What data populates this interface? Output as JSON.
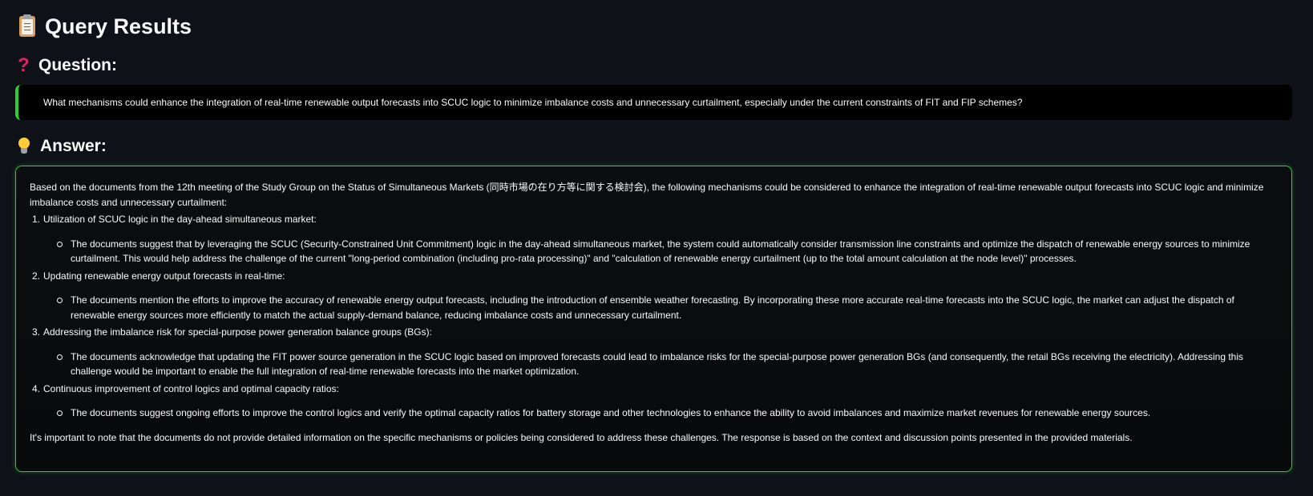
{
  "page": {
    "title": "Query Results",
    "question_heading": "Question:",
    "answer_heading": "Answer:"
  },
  "icons": {
    "title_icon": "clipboard-icon",
    "question_icon": "question-mark-icon",
    "answer_icon": "light-bulb-icon"
  },
  "colors": {
    "background": "#0e1117",
    "accent_green": "#2bd02b",
    "question_mark_red": "#e0245e"
  },
  "question": {
    "text": "What mechanisms could enhance the integration of real-time renewable output forecasts into SCUC logic to minimize imbalance costs and unnecessary curtailment, especially under the current constraints of FIT and FIP schemes?"
  },
  "answer": {
    "intro": "Based on the documents from the 12th meeting of the Study Group on the Status of Simultaneous Markets (同時市場の在り方等に関する検討会), the following mechanisms could be considered to enhance the integration of real-time renewable output forecasts into SCUC logic and minimize imbalance costs and unnecessary curtailment:",
    "points": [
      {
        "number": "1.",
        "title": "Utilization of SCUC logic in the day-ahead simultaneous market:",
        "detail": "The documents suggest that by leveraging the SCUC (Security-Constrained Unit Commitment) logic in the day-ahead simultaneous market, the system could automatically consider transmission line constraints and optimize the dispatch of renewable energy sources to minimize curtailment. This would help address the challenge of the current \"long-period combination (including pro-rata processing)\" and \"calculation of renewable energy curtailment (up to the total amount calculation at the node level)\" processes."
      },
      {
        "number": "2.",
        "title": "Updating renewable energy output forecasts in real-time:",
        "detail": "The documents mention the efforts to improve the accuracy of renewable energy output forecasts, including the introduction of ensemble weather forecasting. By incorporating these more accurate real-time forecasts into the SCUC logic, the market can adjust the dispatch of renewable energy sources more efficiently to match the actual supply-demand balance, reducing imbalance costs and unnecessary curtailment."
      },
      {
        "number": "3.",
        "title": "Addressing the imbalance risk for special-purpose power generation balance groups (BGs):",
        "detail": "The documents acknowledge that updating the FIT power source generation in the SCUC logic based on improved forecasts could lead to imbalance risks for the special-purpose power generation BGs (and consequently, the retail BGs receiving the electricity). Addressing this challenge would be important to enable the full integration of real-time renewable forecasts into the market optimization."
      },
      {
        "number": "4.",
        "title": "Continuous improvement of control logics and optimal capacity ratios:",
        "detail": "The documents suggest ongoing efforts to improve the control logics and verify the optimal capacity ratios for battery storage and other technologies to enhance the ability to avoid imbalances and maximize market revenues for renewable energy sources."
      }
    ],
    "outro": "It's important to note that the documents do not provide detailed information on the specific mechanisms or policies being considered to address these challenges. The response is based on the context and discussion points presented in the provided materials."
  }
}
